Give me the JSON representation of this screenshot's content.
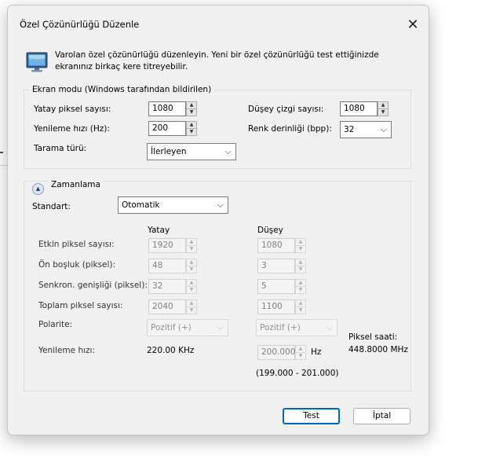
{
  "dialog": {
    "title": "Özel Çözünürlüğü Düzenle",
    "description": "Varolan özel çözünürlüğü düzenleyin. Yeni bir özel çözünürlüğü test ettiğinizde ekranınız birkaç kere titreyebilir."
  },
  "display_mode": {
    "legend": "Ekran modu (Windows tarafından bildirilen)",
    "horizontal_pixels": {
      "label": "Yatay piksel sayısı:",
      "value": "1080"
    },
    "vertical_lines": {
      "label": "Düşey çizgi sayısı:",
      "value": "1080"
    },
    "refresh_rate": {
      "label": "Yenileme hızı (Hz):",
      "value": "200"
    },
    "color_depth": {
      "label": "Renk derinliği (bpp):",
      "value": "32"
    },
    "scan_type": {
      "label": "Tarama türü:",
      "value": "İlerleyen"
    }
  },
  "timing": {
    "legend": "Zamanlama",
    "standard": {
      "label": "Standart:",
      "value": "Otomatik"
    },
    "col_horizontal": "Yatay",
    "col_vertical": "Düşey",
    "rows": [
      {
        "label": "Etkin piksel sayısı:",
        "h": "1920",
        "v": "1080"
      },
      {
        "label": "Ön boşluk (piksel):",
        "h": "48",
        "v": "3"
      },
      {
        "label": "Senkron. genişliği (piksel):",
        "h": "32",
        "v": "5"
      },
      {
        "label": "Toplam piksel sayısı:",
        "h": "2040",
        "v": "1100"
      }
    ],
    "polarity": {
      "label": "Polarite:",
      "h": "Pozitif (+)",
      "v": "Pozitif (+)"
    },
    "refresh": {
      "label": "Yenileme hızı:",
      "h_value": "220.00 KHz",
      "v_value": "200.000",
      "v_unit": "Hz",
      "range": "(199.000 - 201.000)"
    },
    "pixel_clock": {
      "label": "Piksel saati:",
      "value": "448.8000 MHz"
    }
  },
  "buttons": {
    "test": "Test",
    "cancel": "İptal"
  }
}
